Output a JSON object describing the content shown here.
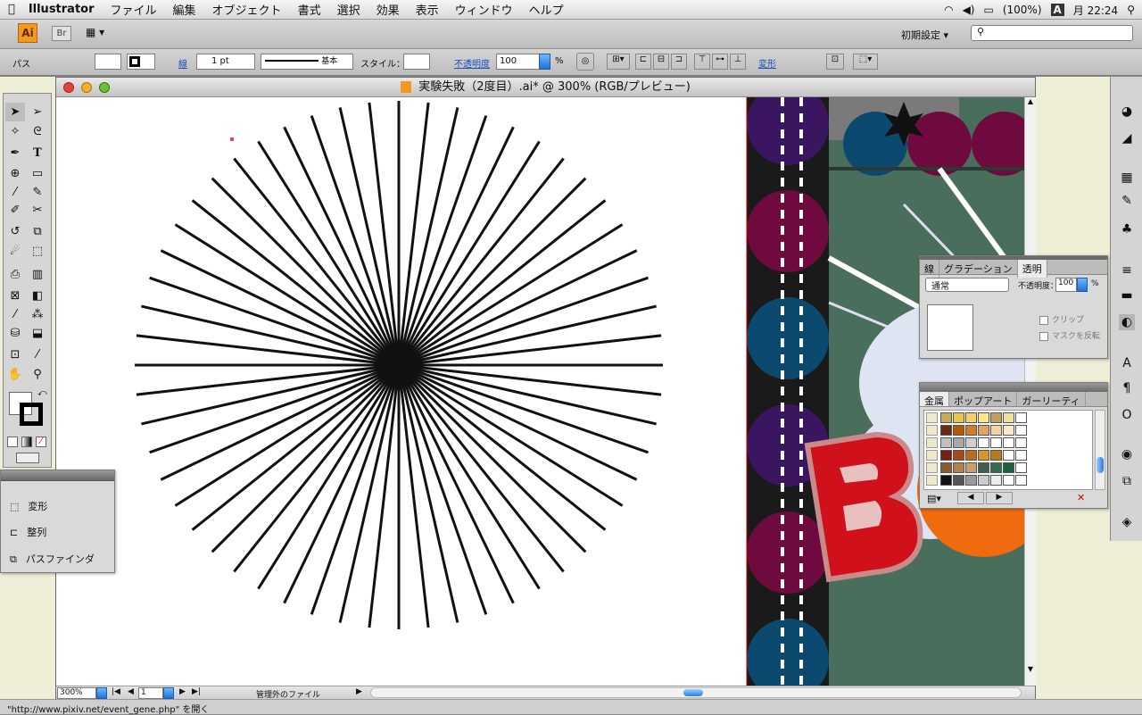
{
  "menubar": {
    "app_name": "Illustrator",
    "items": [
      "ファイル",
      "編集",
      "オブジェクト",
      "書式",
      "選択",
      "効果",
      "表示",
      "ウィンドウ",
      "ヘルプ"
    ],
    "battery": "(100%)",
    "input_method": "A",
    "clock": "月 22:24"
  },
  "appbar": {
    "ai_logo": "Ai",
    "bridge_label": "Br",
    "workspace_label": "初期設定 ▾"
  },
  "control": {
    "object_type": "パス",
    "stroke_label": "線",
    "stroke_weight": "1 pt",
    "brush_label": "基本",
    "style_label": "スタイル：",
    "opacity_label": "不透明度",
    "opacity_value": "100",
    "percent": "%",
    "transform_label": "変形"
  },
  "document": {
    "title": "実験失敗（2度目）.ai* @ 300% (RGB/プレビュー)"
  },
  "status": {
    "zoom": "300%",
    "artboard": "1",
    "file_state": "管理外のファイル"
  },
  "mini_panel": {
    "items": [
      "変形",
      "整列",
      "パスファインダ"
    ]
  },
  "transparency_panel": {
    "tabs": [
      "線",
      "グラデーション",
      "透明"
    ],
    "blend_mode": "通常",
    "opacity_label": "不透明度：",
    "opacity_value": "100",
    "percent": "%",
    "clip_label": "クリップ",
    "invert_label": "マスクを反転"
  },
  "swatch_panel": {
    "tabs": [
      "金属",
      "ポップアート",
      "ガーリーティ"
    ],
    "rows": [
      [
        "#c8a85a",
        "#e9c54a",
        "#f4d06a",
        "#fde58a",
        "#c0a060",
        "#f0e0a0",
        "#ffffff"
      ],
      [
        "#6b2a10",
        "#b8560a",
        "#d27c2c",
        "#e5a062",
        "#f7d1a4",
        "#ffe8c8",
        "#ffffff"
      ],
      [
        "#c0c0c0",
        "#a8a8a8",
        "#d0d0d0",
        "#ffffff",
        "#ffffff",
        "#ffffff",
        "#ffffff"
      ],
      [
        "#7a1e10",
        "#a34a18",
        "#c06a20",
        "#d6962a",
        "#b87a1c",
        "#ffffff",
        "#ffffff"
      ],
      [
        "#8a5a30",
        "#b08050",
        "#c8a070",
        "#3f5f4f",
        "#2f6f4f",
        "#1f5f3f",
        "#ffffff"
      ],
      [
        "#111111",
        "#555555",
        "#999999",
        "#cccccc",
        "#eeeeee",
        "#ffffff",
        "#ffffff"
      ]
    ]
  },
  "url_status": "\"http://www.pixiv.net/event_gene.php\" を開く",
  "colors": {
    "accent": "#1f72d8",
    "artwork_purple": "#3b1660",
    "artwork_magenta": "#6e0a3e",
    "artwork_teal": "#0b4a6e",
    "artwork_green": "#4a6e5c",
    "letter_red": "#d0101a",
    "orange": "#f06a10"
  }
}
